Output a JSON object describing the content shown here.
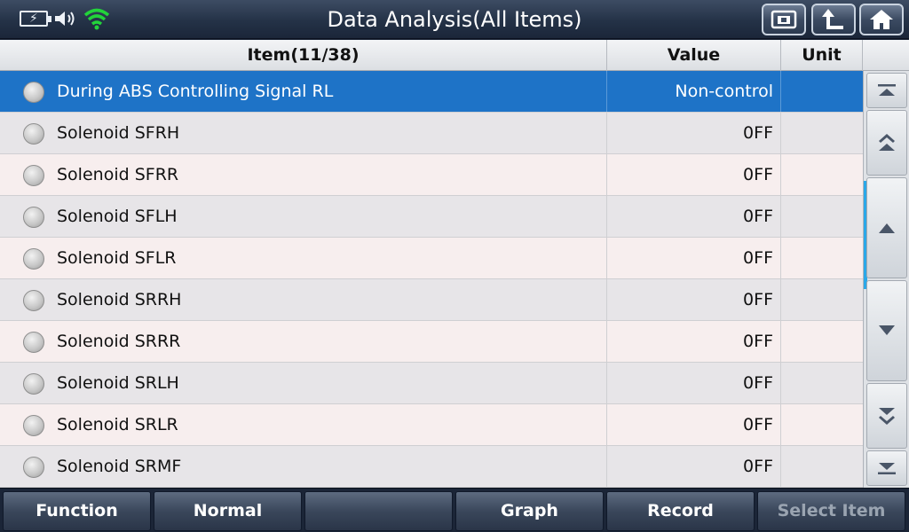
{
  "header": {
    "title": "Data Analysis(All Items)",
    "status_icons": [
      "battery-charging-icon",
      "speaker-icon",
      "wifi-icon"
    ],
    "buttons": [
      "screenshot-icon",
      "back-icon",
      "home-icon"
    ],
    "accent_wifi": "#22d43a"
  },
  "table": {
    "columns": {
      "item": "Item(11/38)",
      "value": "Value",
      "unit": "Unit"
    },
    "rows": [
      {
        "name": "During ABS Controlling Signal RL",
        "value": "Non-control",
        "unit": ""
      },
      {
        "name": "Solenoid SFRH",
        "value": "0FF",
        "unit": ""
      },
      {
        "name": "Solenoid SFRR",
        "value": "0FF",
        "unit": ""
      },
      {
        "name": "Solenoid SFLH",
        "value": "0FF",
        "unit": ""
      },
      {
        "name": "Solenoid SFLR",
        "value": "0FF",
        "unit": ""
      },
      {
        "name": "Solenoid SRRH",
        "value": "0FF",
        "unit": ""
      },
      {
        "name": "Solenoid SRRR",
        "value": "0FF",
        "unit": ""
      },
      {
        "name": "Solenoid SRLH",
        "value": "0FF",
        "unit": ""
      },
      {
        "name": "Solenoid SRLR",
        "value": "0FF",
        "unit": ""
      },
      {
        "name": "Solenoid SRMF",
        "value": "0FF",
        "unit": ""
      }
    ],
    "selected_color": "#1e73c7"
  },
  "scrollbar": {
    "buttons": [
      "scroll-top-icon",
      "page-up-icon",
      "line-up-icon",
      "line-down-icon",
      "page-down-icon",
      "scroll-bottom-icon"
    ]
  },
  "footer": {
    "function": "Function",
    "normal": "Normal",
    "blank": "",
    "graph": "Graph",
    "record": "Record",
    "select_item": "Select Item"
  }
}
